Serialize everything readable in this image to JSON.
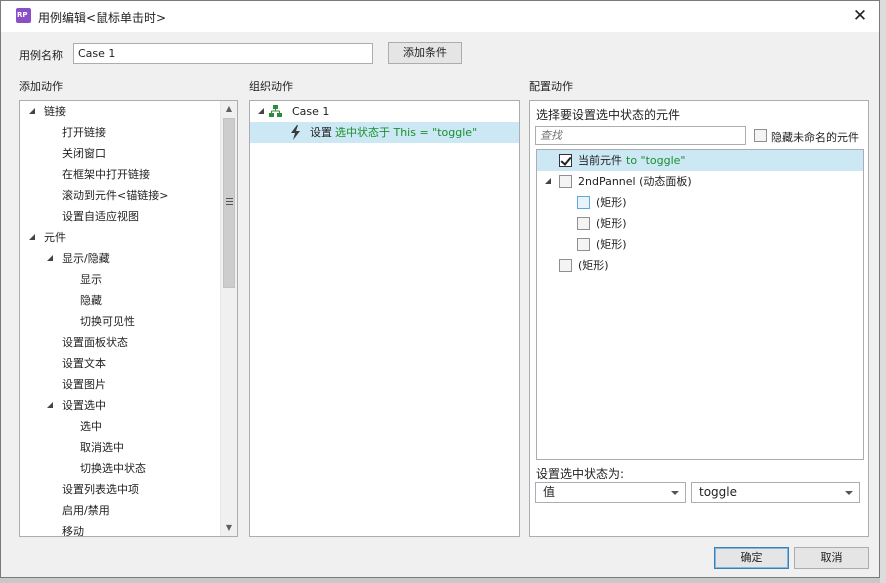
{
  "window": {
    "title": "用例编辑<鼠标单击时>",
    "app_icon_text": "RP"
  },
  "case_name": {
    "label": "用例名称",
    "value": "Case 1",
    "add_condition": "添加条件"
  },
  "add_actions": {
    "header": "添加动作",
    "items": [
      {
        "label": "链接",
        "level": 0,
        "arrow": "expanded"
      },
      {
        "label": "打开链接",
        "level": 1,
        "arrow": "collapsed"
      },
      {
        "label": "关闭窗口",
        "level": 1,
        "arrow": "none"
      },
      {
        "label": "在框架中打开链接",
        "level": 1,
        "arrow": "collapsed"
      },
      {
        "label": "滚动到元件<锚链接>",
        "level": 1,
        "arrow": "none"
      },
      {
        "label": "设置自适应视图",
        "level": 1,
        "arrow": "none"
      },
      {
        "label": "元件",
        "level": 0,
        "arrow": "expanded"
      },
      {
        "label": "显示/隐藏",
        "level": 1,
        "arrow": "expanded"
      },
      {
        "label": "显示",
        "level": 2,
        "arrow": "none"
      },
      {
        "label": "隐藏",
        "level": 2,
        "arrow": "none"
      },
      {
        "label": "切换可见性",
        "level": 2,
        "arrow": "none"
      },
      {
        "label": "设置面板状态",
        "level": 1,
        "arrow": "none"
      },
      {
        "label": "设置文本",
        "level": 1,
        "arrow": "none"
      },
      {
        "label": "设置图片",
        "level": 1,
        "arrow": "none"
      },
      {
        "label": "设置选中",
        "level": 1,
        "arrow": "expanded"
      },
      {
        "label": "选中",
        "level": 2,
        "arrow": "none"
      },
      {
        "label": "取消选中",
        "level": 2,
        "arrow": "none"
      },
      {
        "label": "切换选中状态",
        "level": 2,
        "arrow": "none"
      },
      {
        "label": "设置列表选中项",
        "level": 1,
        "arrow": "none"
      },
      {
        "label": "启用/禁用",
        "level": 1,
        "arrow": "collapsed"
      },
      {
        "label": "移动",
        "level": 1,
        "arrow": "none"
      }
    ]
  },
  "organize": {
    "header": "组织动作",
    "case_label": "Case 1",
    "action_prefix": "设置",
    "action_detail": "选中状态于 This = \"toggle\""
  },
  "configure": {
    "header": "配置动作",
    "subheader": "选择要设置选中状态的元件",
    "search_placeholder": "查找",
    "hide_unnamed": "隐藏未命名的元件",
    "widgets": [
      {
        "label": "当前元件",
        "suffix": " to \"toggle\"",
        "level": 0,
        "checked": true,
        "arrow": "none",
        "selected": true
      },
      {
        "label": "2ndPannel (动态面板)",
        "suffix": "",
        "level": 0,
        "checked": false,
        "arrow": "expanded",
        "selected": false
      },
      {
        "label": "(矩形)",
        "suffix": "",
        "level": 1,
        "checked": false,
        "arrow": "none",
        "selected": false,
        "highlight": true
      },
      {
        "label": "(矩形)",
        "suffix": "",
        "level": 1,
        "checked": false,
        "arrow": "none",
        "selected": false
      },
      {
        "label": "(矩形)",
        "suffix": "",
        "level": 1,
        "checked": false,
        "arrow": "none",
        "selected": false
      },
      {
        "label": "(矩形)",
        "suffix": "",
        "level": 0,
        "checked": false,
        "arrow": "none",
        "selected": false
      }
    ],
    "set_state_label": "设置选中状态为:",
    "mode_select": "值",
    "value_select": "toggle"
  },
  "footer": {
    "ok": "确定",
    "cancel": "取消"
  },
  "colors": {
    "selection": "#cce8f4",
    "green_text": "#1a8f2e",
    "app_icon": "#8a4fc7"
  }
}
